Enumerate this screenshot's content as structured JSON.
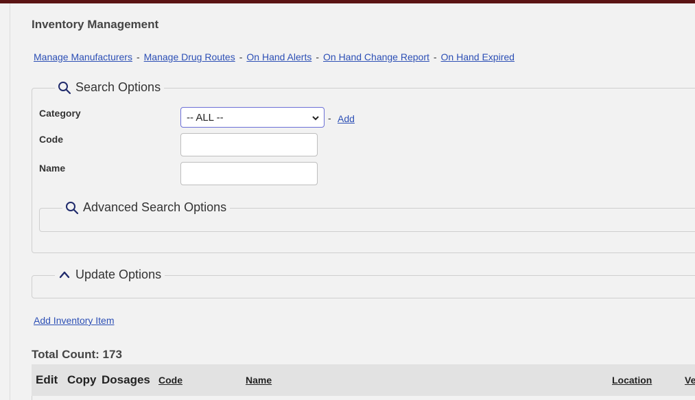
{
  "page": {
    "title": "Inventory Management"
  },
  "nav_links": [
    {
      "label": "Manage Manufacturers"
    },
    {
      "label": "Manage Drug Routes"
    },
    {
      "label": "On Hand Alerts"
    },
    {
      "label": "On Hand Change Report"
    },
    {
      "label": "On Hand Expired"
    }
  ],
  "nav_separator": "-",
  "search_options": {
    "legend": "Search Options",
    "icon": "search-icon",
    "category_label": "Category",
    "category_value": "-- ALL --",
    "category_add_sep": "-",
    "category_add": "Add",
    "code_label": "Code",
    "code_value": "",
    "name_label": "Name",
    "name_value": "",
    "advanced_legend": "Advanced Search Options"
  },
  "update_options": {
    "legend": "Update Options",
    "icon": "chevron-up-icon"
  },
  "add_item_link": "Add Inventory Item",
  "total_count": "Total Count: 173",
  "table": {
    "headers": [
      {
        "label": "Edit",
        "sortable": false
      },
      {
        "label": "Copy",
        "sortable": false
      },
      {
        "label": "Dosages",
        "sortable": false
      },
      {
        "label": "Code",
        "sortable": true
      },
      {
        "label": "Name",
        "sortable": true
      },
      {
        "label": "Location",
        "sortable": true
      },
      {
        "label": "Ve",
        "sortable": true
      }
    ]
  },
  "colors": {
    "top_bar": "#5b1414",
    "link": "#2c4fb5",
    "select_border": "#6b6fd6"
  }
}
